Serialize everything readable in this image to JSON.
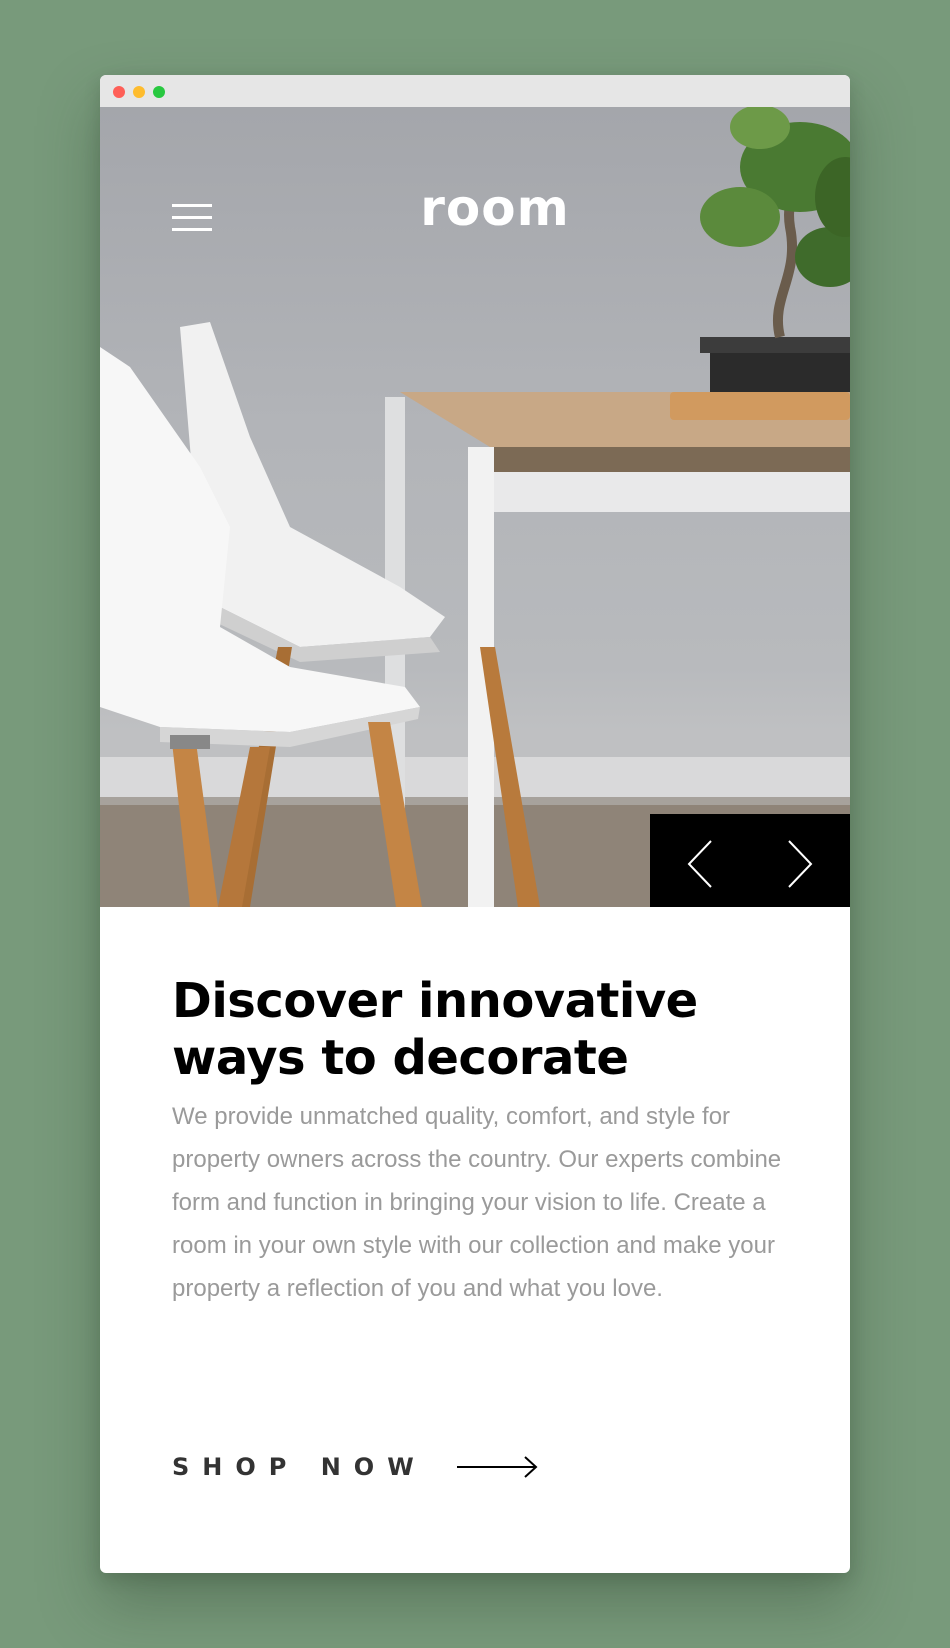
{
  "header": {
    "logo": "room",
    "menu_icon": "hamburger-menu-icon"
  },
  "hero": {
    "prev_icon": "chevron-left-icon",
    "next_icon": "chevron-right-icon"
  },
  "main": {
    "headline": "Discover innovative ways to decorate",
    "body": "We provide unmatched quality, comfort, and style for property owners across the country. Our experts combine form and function in bringing your vision to life. Create a room in your own style with our collection and make your property a reflection of you and what you love.",
    "cta_label": "SHOP NOW",
    "cta_icon": "arrow-right-icon"
  },
  "colors": {
    "page_background": "#789a7b",
    "headline": "#000000",
    "body_text": "#9a9a9a",
    "slider_background": "#000000"
  }
}
